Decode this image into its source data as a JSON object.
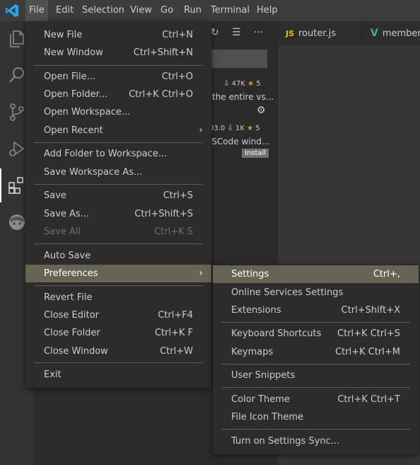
{
  "menubar": {
    "items": [
      "File",
      "Edit",
      "Selection",
      "View",
      "Go",
      "Run",
      "Terminal",
      "Help"
    ]
  },
  "sidebar": {
    "ext1": {
      "downloads": "47K",
      "rating": "5",
      "desc": "the entire vs..."
    },
    "ext2": {
      "version": "03.0",
      "downloads": "1K",
      "rating": "5",
      "desc": "'SCode wind...",
      "install": "Install"
    }
  },
  "tabs": [
    {
      "badge": "JS",
      "label": "router.js"
    },
    {
      "badge": "V",
      "label": "member"
    }
  ],
  "file_menu": [
    {
      "label": "New File",
      "kb": "Ctrl+N"
    },
    {
      "label": "New Window",
      "kb": "Ctrl+Shift+N"
    },
    {
      "label": "Open File...",
      "kb": "Ctrl+O"
    },
    {
      "label": "Open Folder...",
      "kb": "Ctrl+K Ctrl+O"
    },
    {
      "label": "Open Workspace...",
      "kb": ""
    },
    {
      "label": "Open Recent",
      "kb": ""
    },
    {
      "label": "Add Folder to Workspace...",
      "kb": ""
    },
    {
      "label": "Save Workspace As...",
      "kb": ""
    },
    {
      "label": "Save",
      "kb": "Ctrl+S"
    },
    {
      "label": "Save As...",
      "kb": "Ctrl+Shift+S"
    },
    {
      "label": "Save All",
      "kb": "Ctrl+K S"
    },
    {
      "label": "Auto Save",
      "kb": ""
    },
    {
      "label": "Preferences",
      "kb": ""
    },
    {
      "label": "Revert File",
      "kb": ""
    },
    {
      "label": "Close Editor",
      "kb": "Ctrl+F4"
    },
    {
      "label": "Close Folder",
      "kb": "Ctrl+K F"
    },
    {
      "label": "Close Window",
      "kb": "Ctrl+W"
    },
    {
      "label": "Exit",
      "kb": ""
    }
  ],
  "prefs_menu": [
    {
      "label": "Settings",
      "kb": "Ctrl+,"
    },
    {
      "label": "Online Services Settings",
      "kb": ""
    },
    {
      "label": "Extensions",
      "kb": "Ctrl+Shift+X"
    },
    {
      "label": "Keyboard Shortcuts",
      "kb": "Ctrl+K Ctrl+S"
    },
    {
      "label": "Keymaps",
      "kb": "Ctrl+K Ctrl+M"
    },
    {
      "label": "User Snippets",
      "kb": ""
    },
    {
      "label": "Color Theme",
      "kb": "Ctrl+K Ctrl+T"
    },
    {
      "label": "File Icon Theme",
      "kb": ""
    },
    {
      "label": "Turn on Settings Sync...",
      "kb": ""
    }
  ],
  "colors": {
    "highlight": "#676454",
    "vscode_blue": "#23a9f2",
    "star": "#e0a000"
  },
  "icons": [
    "vscode-logo-icon",
    "explorer-icon",
    "search-icon",
    "source-control-icon",
    "run-debug-icon",
    "extensions-icon",
    "account-avatar-icon",
    "submenu-chevron-icon",
    "gear-icon",
    "download-icon",
    "star-icon"
  ]
}
